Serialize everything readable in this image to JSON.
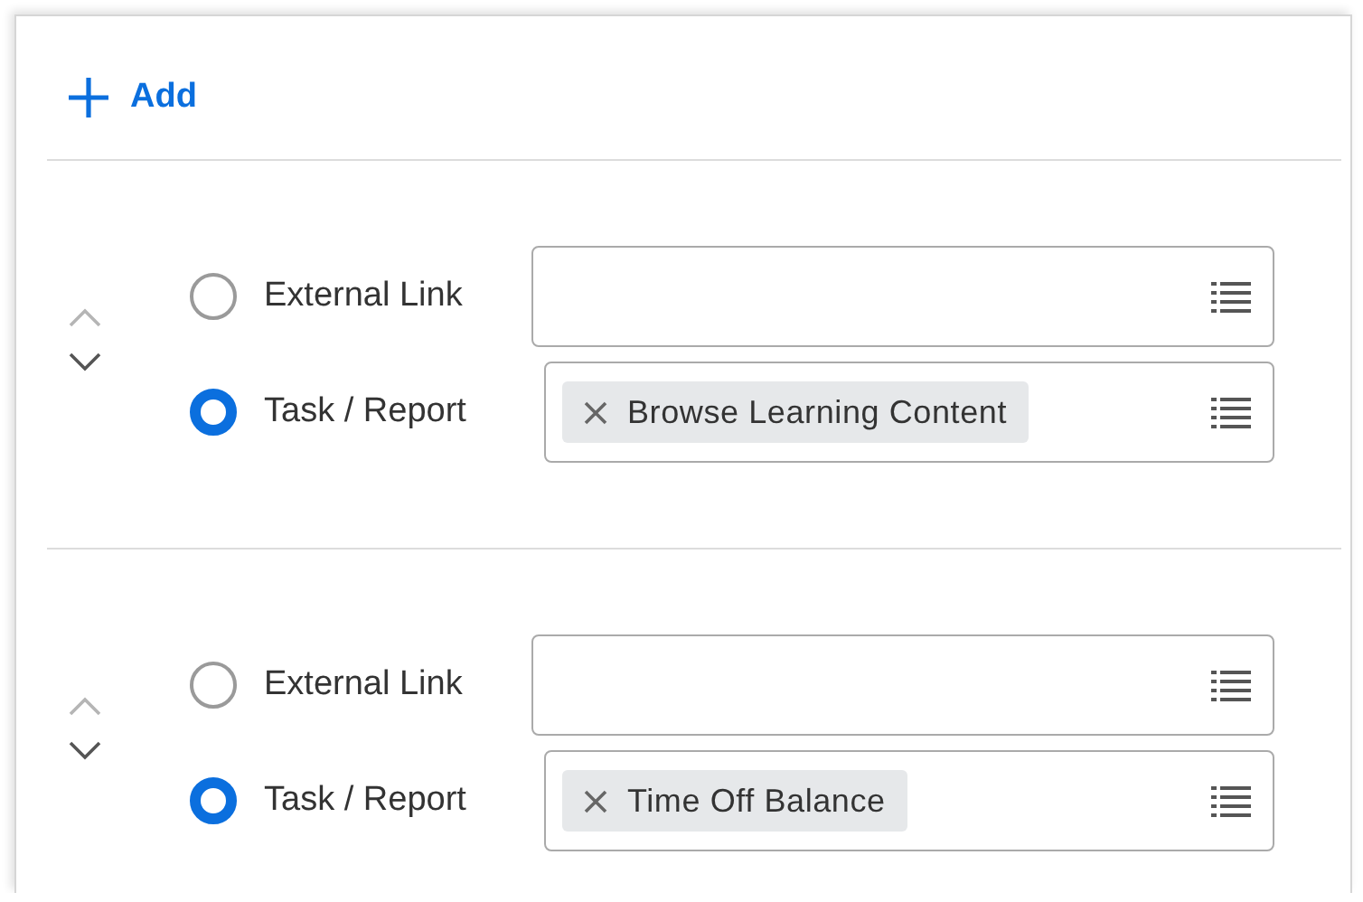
{
  "add_button": {
    "label": "Add"
  },
  "entries": [
    {
      "move_up": {
        "disabled": true
      },
      "move_down": {
        "disabled": false
      },
      "options": [
        {
          "label": "External Link",
          "selected": false
        },
        {
          "label": "Task / Report",
          "selected": true,
          "tag": "Browse Learning Content"
        }
      ]
    },
    {
      "move_up": {
        "disabled": true
      },
      "move_down": {
        "disabled": false
      },
      "options": [
        {
          "label": "External Link",
          "selected": false
        },
        {
          "label": "Task / Report",
          "selected": true,
          "tag": "Time Off Balance"
        }
      ]
    }
  ]
}
